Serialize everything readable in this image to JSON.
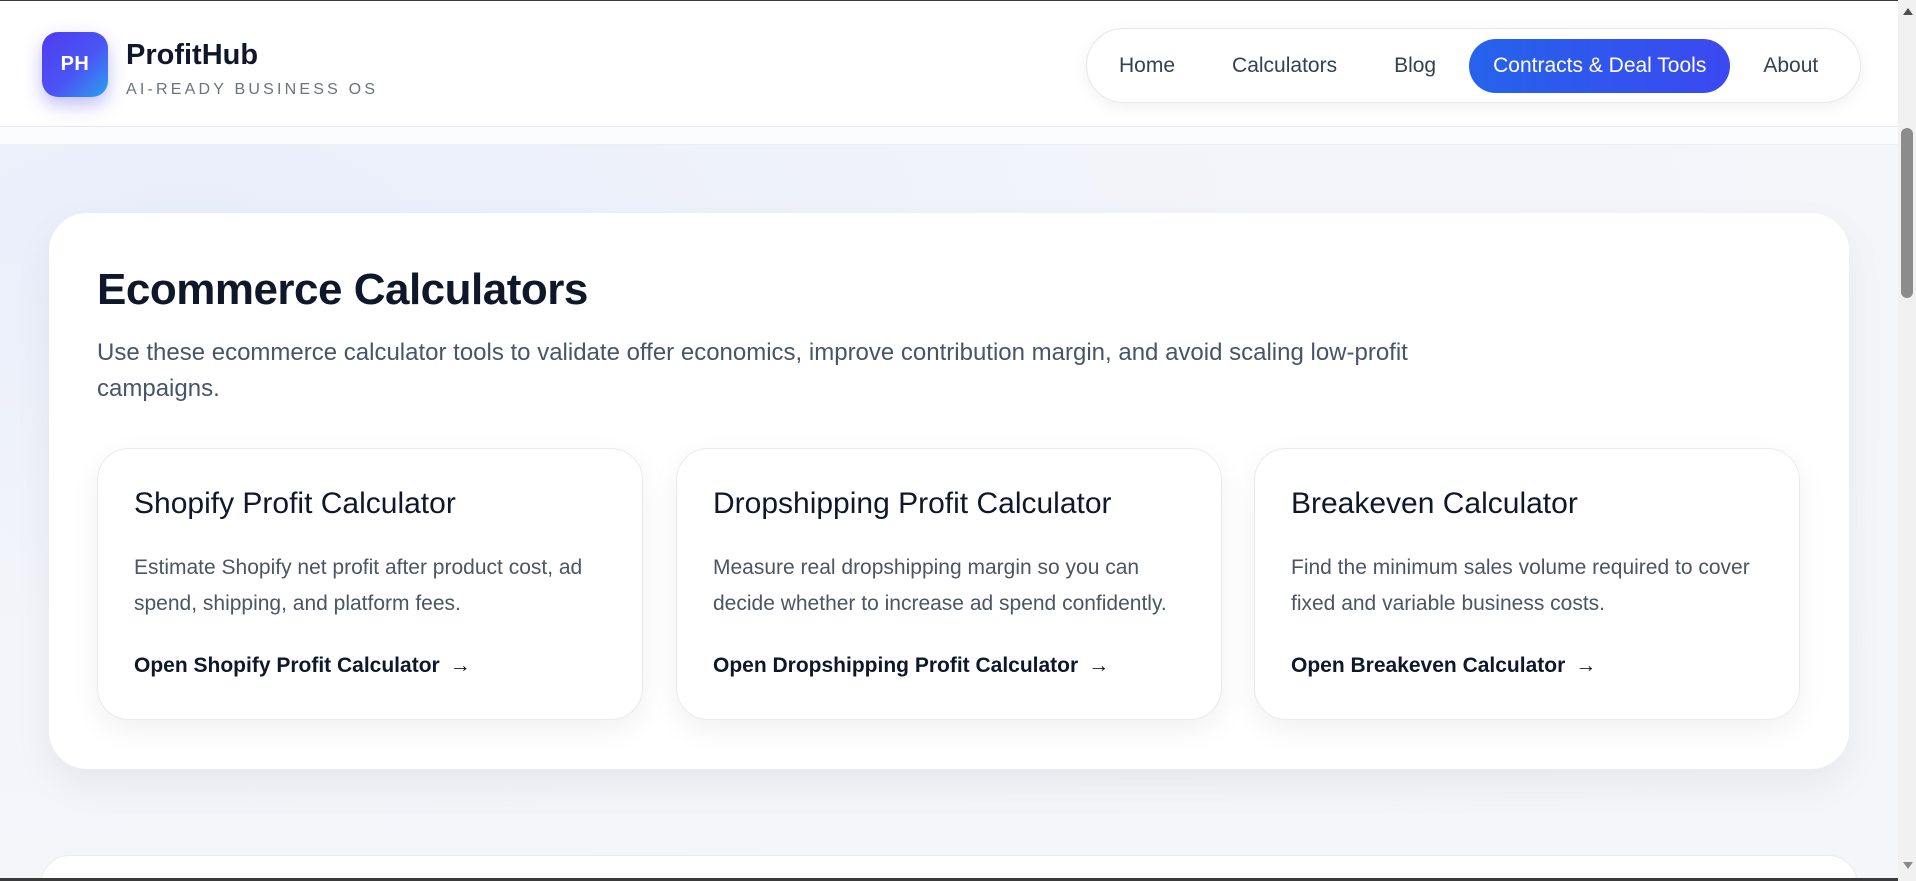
{
  "brand": {
    "badge": "PH",
    "name": "ProfitHub",
    "tagline": "AI-READY BUSINESS OS"
  },
  "nav": {
    "items": [
      {
        "label": "Home",
        "active": false
      },
      {
        "label": "Calculators",
        "active": false
      },
      {
        "label": "Blog",
        "active": false
      },
      {
        "label": "Contracts & Deal Tools",
        "active": true
      },
      {
        "label": "About",
        "active": false
      }
    ]
  },
  "section": {
    "title": "Ecommerce Calculators",
    "description": "Use these ecommerce calculator tools to validate offer economics, improve contribution margin, and avoid scaling low-profit campaigns."
  },
  "cards": [
    {
      "title": "Shopify Profit Calculator",
      "description": "Estimate Shopify net profit after product cost, ad spend, shipping, and platform fees.",
      "link": "Open Shopify Profit Calculator",
      "arrow": "→"
    },
    {
      "title": "Dropshipping Profit Calculator",
      "description": "Measure real dropshipping margin so you can decide whether to increase ad spend confidently.",
      "link": "Open Dropshipping Profit Calculator",
      "arrow": "→"
    },
    {
      "title": "Breakeven Calculator",
      "description": "Find the minimum sales volume required to cover fixed and variable business costs.",
      "link": "Open Breakeven Calculator",
      "arrow": "→"
    }
  ],
  "colors": {
    "accent": "#2563eb",
    "brand_gradient_start": "#4f3bf0",
    "brand_gradient_end": "#2aa0f0",
    "text_primary": "#0f172a",
    "text_secondary": "#475569"
  }
}
